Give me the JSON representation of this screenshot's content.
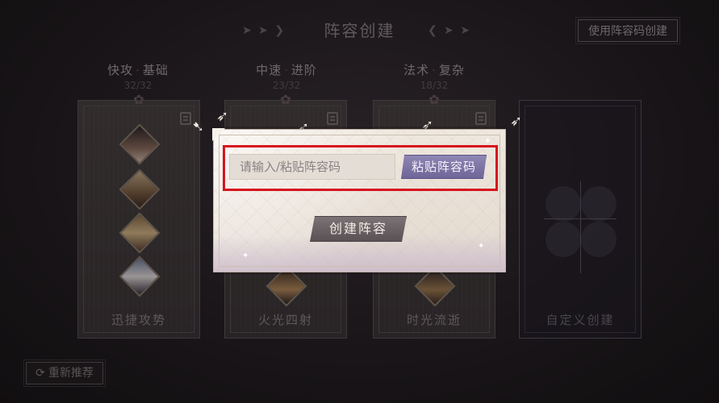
{
  "header": {
    "title": "阵容创建",
    "use_code_button": "使用阵容码创建"
  },
  "lineups": [
    {
      "name_a": "快攻",
      "name_b": "基础",
      "count": "32/32",
      "label": "迅捷攻势"
    },
    {
      "name_a": "中速",
      "name_b": "进阶",
      "count": "23/32",
      "label": "火光四射"
    },
    {
      "name_a": "法术",
      "name_b": "复杂",
      "count": "18/32",
      "label": "时光流逝"
    }
  ],
  "custom_card": {
    "label": "自定义创建"
  },
  "footer": {
    "refresh_button": "重新推荐"
  },
  "modal": {
    "input_placeholder": "请输入/粘贴阵容码",
    "input_value": "",
    "paste_button": "粘贴阵容码",
    "create_button": "创建阵容"
  },
  "icons": {
    "refresh": "refresh-icon",
    "lineup_doc": "document-icon",
    "bird": "swallow-bird-icon"
  },
  "colors": {
    "highlight": "#d7141e",
    "paste_button": "#7d74a8",
    "create_button": "#6a6164",
    "modal_bg": "#ece5dc"
  }
}
